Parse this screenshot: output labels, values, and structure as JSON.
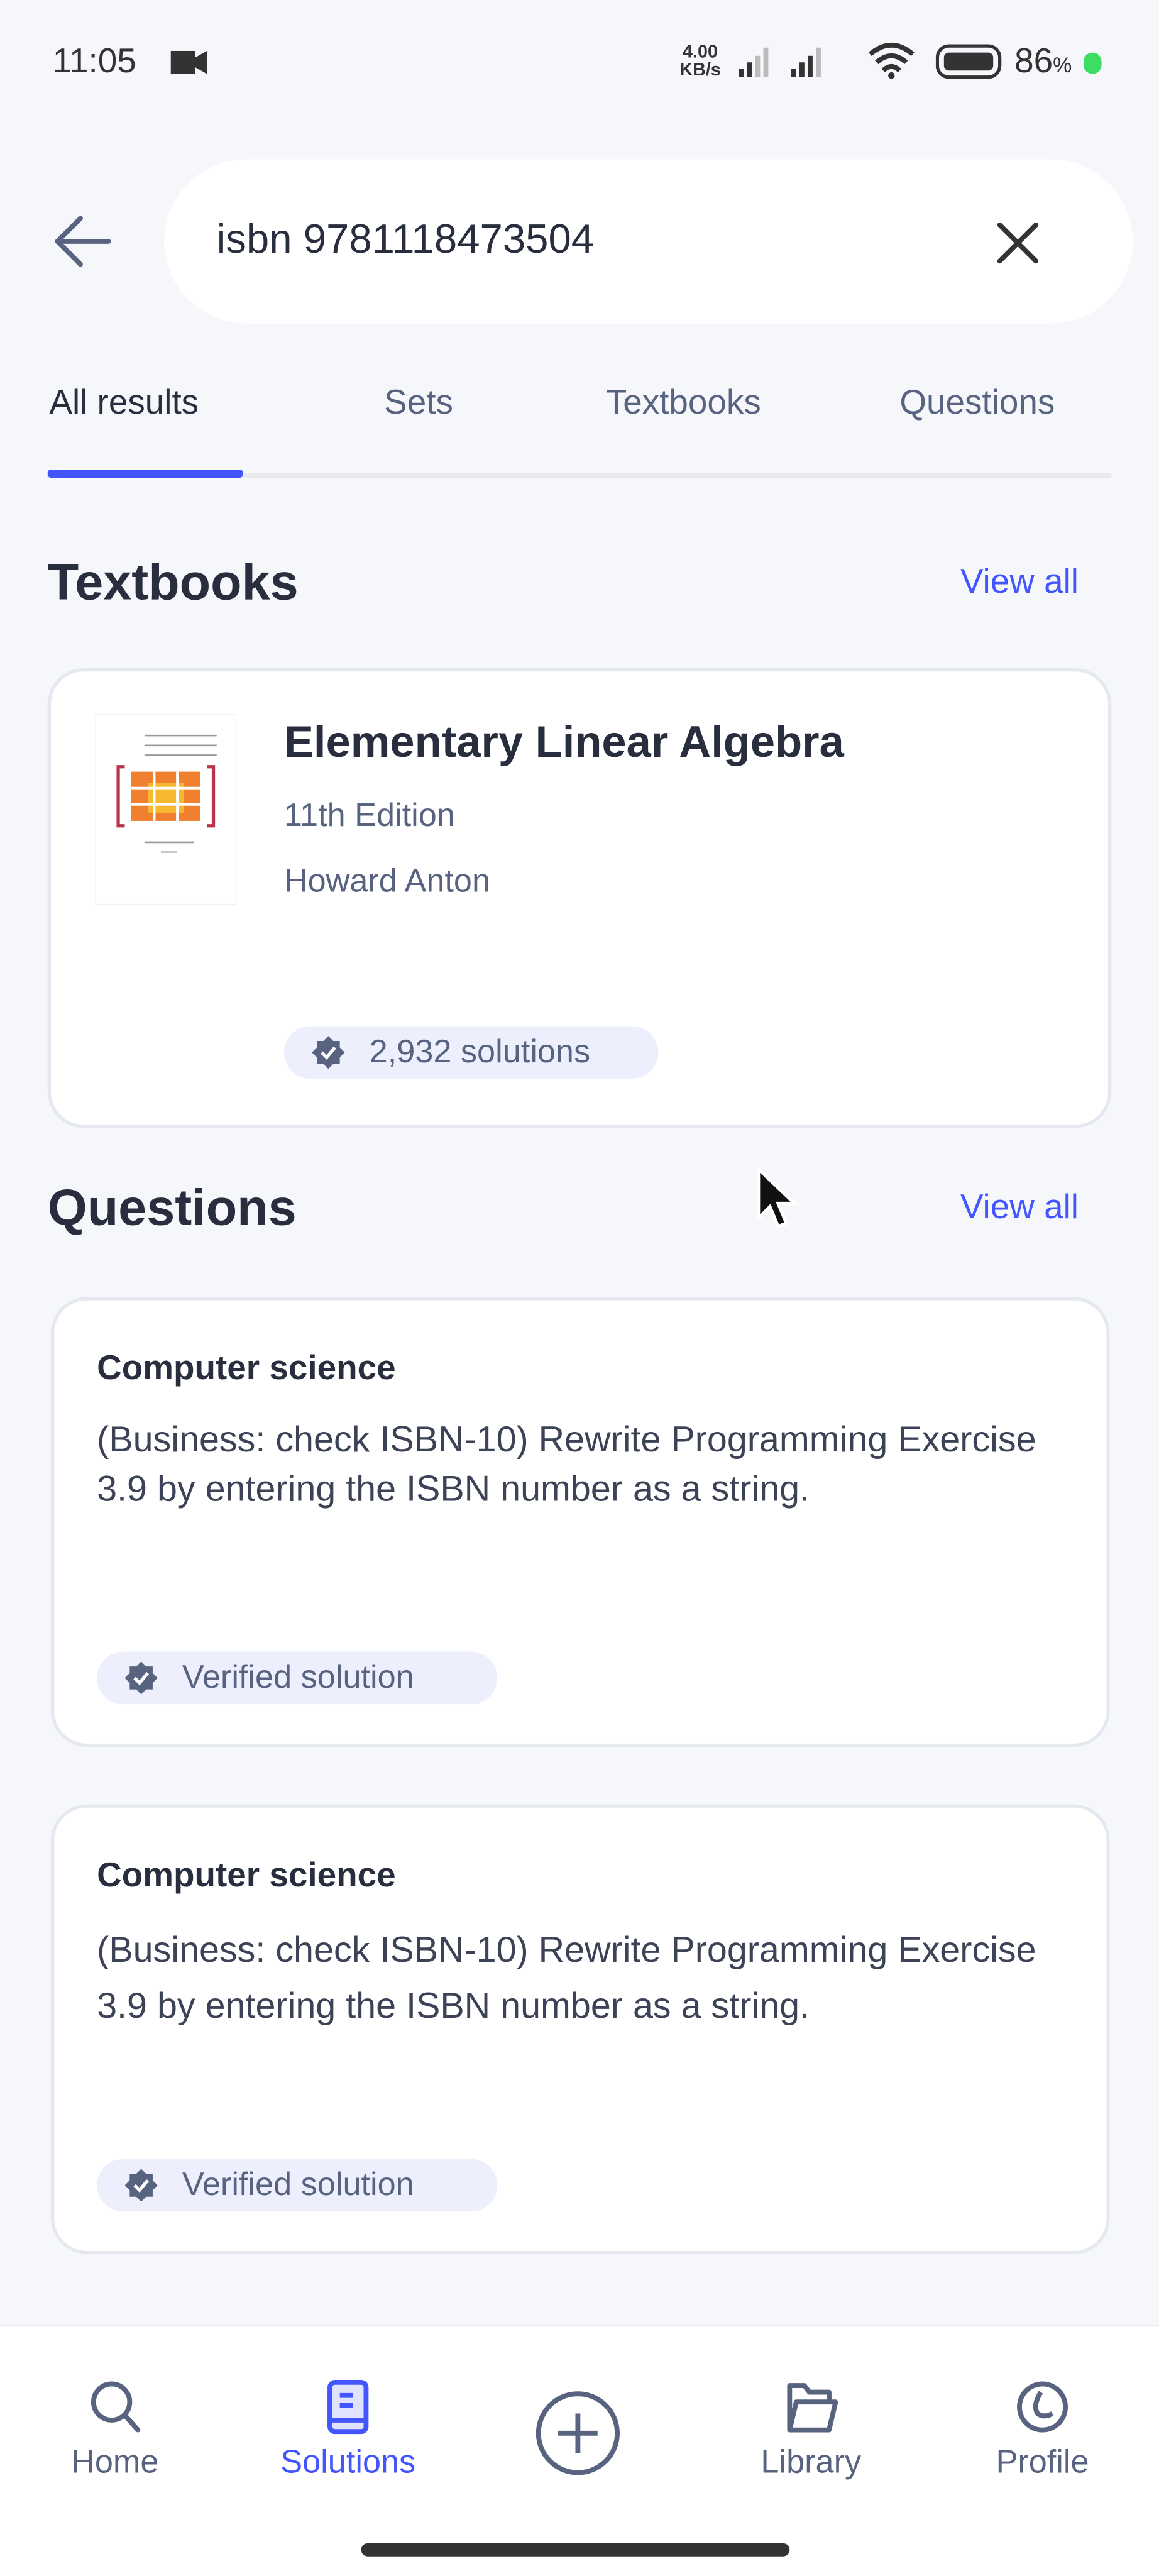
{
  "status_bar": {
    "time": "11:05",
    "net_speed_value": "4.00",
    "net_speed_unit": "KB/s",
    "battery": "86",
    "battery_unit": "%",
    "icons": [
      "video-record-icon",
      "signal-icon",
      "signal-icon",
      "wifi-icon",
      "battery-icon"
    ]
  },
  "search": {
    "value": "isbn 9781118473504",
    "back_icon": "arrow-left-icon",
    "clear_icon": "close-icon"
  },
  "tabs": [
    {
      "label": "All results",
      "active": true
    },
    {
      "label": "Sets"
    },
    {
      "label": "Textbooks"
    },
    {
      "label": "Questions"
    }
  ],
  "accent": "#4255ff",
  "textbooks": {
    "title": "Textbooks",
    "view_all": "View all",
    "items": [
      {
        "title": "Elementary Linear Algebra",
        "edition": "11th Edition",
        "author": "Howard Anton",
        "solutions": "2,932 solutions"
      }
    ]
  },
  "questions": {
    "title": "Questions",
    "view_all": "View all",
    "items": [
      {
        "subject": "Computer science",
        "text": "(Business: check ISBN-10) Rewrite Programming Exercise 3.9 by entering the ISBN number as a string.",
        "badge": "Verified solution"
      },
      {
        "subject": "Computer science",
        "text": "(Business: check ISBN-10) Rewrite Programming Exercise 3.9 by entering the ISBN number as a string.",
        "badge": "Verified solution"
      }
    ]
  },
  "bottom_nav": [
    {
      "label": "Home",
      "icon": "search-icon"
    },
    {
      "label": "Solutions",
      "icon": "book-icon",
      "active": true
    },
    {
      "label": "",
      "icon": "plus-circle-icon"
    },
    {
      "label": "Library",
      "icon": "folder-icon"
    },
    {
      "label": "Profile",
      "icon": "profile-icon"
    }
  ]
}
